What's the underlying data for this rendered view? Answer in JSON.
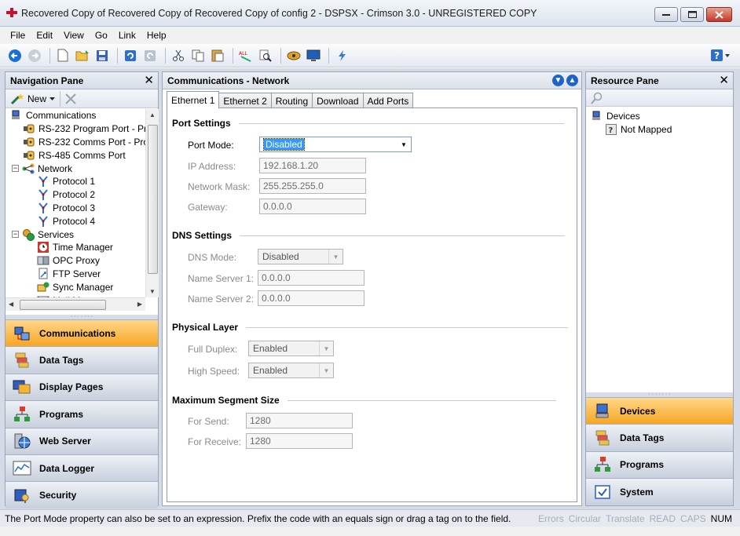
{
  "window": {
    "title": "Recovered Copy of Recovered Copy of Recovered Copy of config 2 - DSPSX - Crimson 3.0 - UNREGISTERED COPY"
  },
  "menu": [
    "File",
    "Edit",
    "View",
    "Go",
    "Link",
    "Help"
  ],
  "nav": {
    "title": "Navigation Pane",
    "new_label": "New",
    "tree": [
      {
        "label": "Communications",
        "level": 0,
        "icon": "computer-icon"
      },
      {
        "label": "RS-232 Program Port - Pr",
        "level": 1,
        "icon": "serial-port-icon"
      },
      {
        "label": "RS-232 Comms Port - Pro",
        "level": 1,
        "icon": "serial-port-icon"
      },
      {
        "label": "RS-485 Comms Port",
        "level": 1,
        "icon": "serial-port-icon"
      },
      {
        "label": "Network",
        "level": 1,
        "icon": "network-icon",
        "expander": "−"
      },
      {
        "label": "Protocol 1",
        "level": 2,
        "icon": "protocol-icon"
      },
      {
        "label": "Protocol 2",
        "level": 2,
        "icon": "protocol-icon"
      },
      {
        "label": "Protocol 3",
        "level": 2,
        "icon": "protocol-icon"
      },
      {
        "label": "Protocol 4",
        "level": 2,
        "icon": "protocol-icon"
      },
      {
        "label": "Services",
        "level": 1,
        "icon": "services-icon",
        "expander": "−"
      },
      {
        "label": "Time Manager",
        "level": 2,
        "icon": "clock-icon"
      },
      {
        "label": "OPC Proxy",
        "level": 2,
        "icon": "opc-icon"
      },
      {
        "label": "FTP Server",
        "level": 2,
        "icon": "ftp-icon"
      },
      {
        "label": "Sync Manager",
        "level": 2,
        "icon": "sync-icon"
      },
      {
        "label": "Mail M",
        "level": 2,
        "icon": "mail-icon"
      }
    ],
    "categories": [
      {
        "label": "Communications",
        "active": true
      },
      {
        "label": "Data Tags",
        "active": false
      },
      {
        "label": "Display Pages",
        "active": false
      },
      {
        "label": "Programs",
        "active": false
      },
      {
        "label": "Web Server",
        "active": false
      },
      {
        "label": "Data Logger",
        "active": false
      },
      {
        "label": "Security",
        "active": false
      }
    ]
  },
  "center": {
    "title": "Communications - Network",
    "tabs": [
      "Ethernet 1",
      "Ethernet 2",
      "Routing",
      "Download",
      "Add Ports"
    ],
    "active_tab": 0,
    "port_settings": {
      "heading": "Port Settings",
      "port_mode_label": "Port Mode:",
      "port_mode_value": "Disabled",
      "ip_label": "IP Address:",
      "ip_value": "192.168.1.20",
      "mask_label": "Network Mask:",
      "mask_value": "255.255.255.0",
      "gateway_label": "Gateway:",
      "gateway_value": "0.0.0.0"
    },
    "dns_settings": {
      "heading": "DNS Settings",
      "mode_label": "DNS Mode:",
      "mode_value": "Disabled",
      "ns1_label": "Name Server 1:",
      "ns1_value": "0.0.0.0",
      "ns2_label": "Name Server 2:",
      "ns2_value": "0.0.0.0"
    },
    "physical_layer": {
      "heading": "Physical Layer",
      "duplex_label": "Full Duplex:",
      "duplex_value": "Enabled",
      "speed_label": "High Speed:",
      "speed_value": "Enabled"
    },
    "segment": {
      "heading": "Maximum Segment Size",
      "send_label": "For Send:",
      "send_value": "1280",
      "receive_label": "For Receive:",
      "receive_value": "1280"
    }
  },
  "resource": {
    "title": "Resource Pane",
    "tree": [
      {
        "label": "Devices",
        "icon": "computer-icon"
      },
      {
        "label": "Not Mapped",
        "icon": "question-icon"
      }
    ],
    "categories": [
      {
        "label": "Devices",
        "active": true
      },
      {
        "label": "Data Tags",
        "active": false
      },
      {
        "label": "Programs",
        "active": false
      },
      {
        "label": "System",
        "active": false
      }
    ]
  },
  "status": {
    "message": "The Port Mode property can also be set to an expression. Prefix the code with an equals sign or drag a tag on to the field.",
    "indicators": [
      {
        "label": "Errors",
        "on": false
      },
      {
        "label": "Circular",
        "on": false
      },
      {
        "label": "Translate",
        "on": false
      },
      {
        "label": "READ",
        "on": false
      },
      {
        "label": "CAPS",
        "on": false
      },
      {
        "label": "NUM",
        "on": true
      }
    ]
  }
}
